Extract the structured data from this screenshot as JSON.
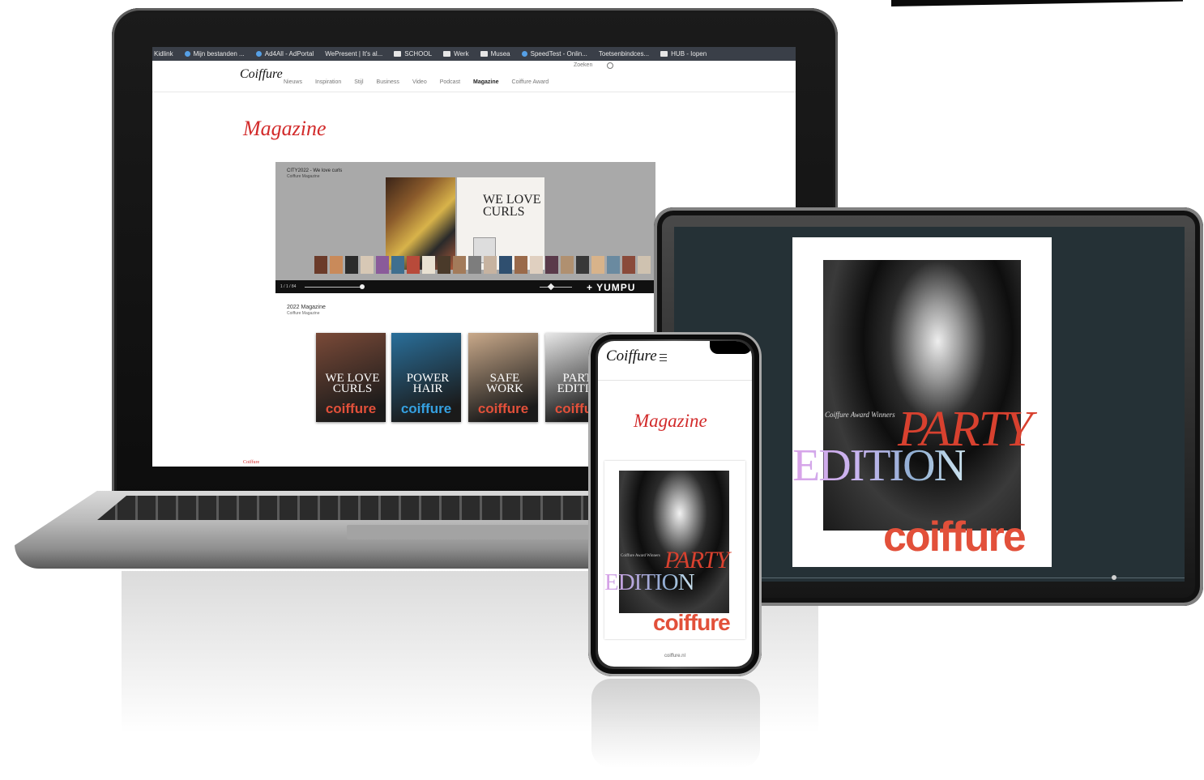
{
  "browser": {
    "bookmarks": [
      {
        "label": "Kidlink",
        "icon": "none-icon"
      },
      {
        "label": "Mijn bestanden ...",
        "icon": "cloud-icon"
      },
      {
        "label": "Ad4All - AdPortal",
        "icon": "diamond-icon"
      },
      {
        "label": "WePresent | It's al...",
        "icon": "none-icon"
      },
      {
        "label": "SCHOOL",
        "icon": "folder-icon"
      },
      {
        "label": "Werk",
        "icon": "folder-icon"
      },
      {
        "label": "Musea",
        "icon": "folder-icon"
      },
      {
        "label": "SpeedTest - Onlin...",
        "icon": "speed-icon"
      },
      {
        "label": "Toetsenbindces...",
        "icon": "none-icon"
      },
      {
        "label": "HUB - Iopen",
        "icon": "folder-icon"
      }
    ]
  },
  "site": {
    "logo": "Coiffure",
    "nav": [
      "Nieuws",
      "Inspiration",
      "Stijl",
      "Business",
      "Video",
      "Podcast",
      "Magazine",
      "Coiffure Award"
    ],
    "active_nav": "Magazine",
    "util_label": "Zoeken",
    "heading": "Magazine",
    "viewer": {
      "caption": "CITY2022 - We love curls",
      "caption_sub": "Coiffure Magazine",
      "spread_title": "WE LOVE CURLS",
      "brand": "+ YUMPU",
      "page_indicator": "1 / 1 / 84"
    },
    "archive_label": "2022 Magazine",
    "archive_sub": "Coiffure Magazine",
    "covers": [
      {
        "title": "WE LOVE CURLS",
        "logo": "coiffure",
        "bg": "#7a4a38"
      },
      {
        "title": "POWER HAIR",
        "logo": "coiffure",
        "bg": "#2a6f9a"
      },
      {
        "title": "SAFE WORK",
        "logo": "coiffure",
        "bg": "#c9a98a"
      },
      {
        "title": "PARTY EDITION",
        "logo": "coiffure",
        "bg": "#e8e8e8"
      }
    ],
    "footer_text": "Coiffure"
  },
  "tablet": {
    "subline": "Coiffure Award Winners",
    "title_1": "PARTY",
    "title_2": "EDITION",
    "logo": "coiffure"
  },
  "phone": {
    "logo": "Coiffure",
    "heading": "Magazine",
    "subline": "Coiffure Award Winners",
    "title_1": "PARTY",
    "title_2": "EDITION",
    "logo_cover": "coiffure",
    "url": "coiffure.nl"
  },
  "colors": {
    "brand_red": "#d22b2b",
    "cover_orange": "#e2503a",
    "tablet_bg": "#253136"
  }
}
